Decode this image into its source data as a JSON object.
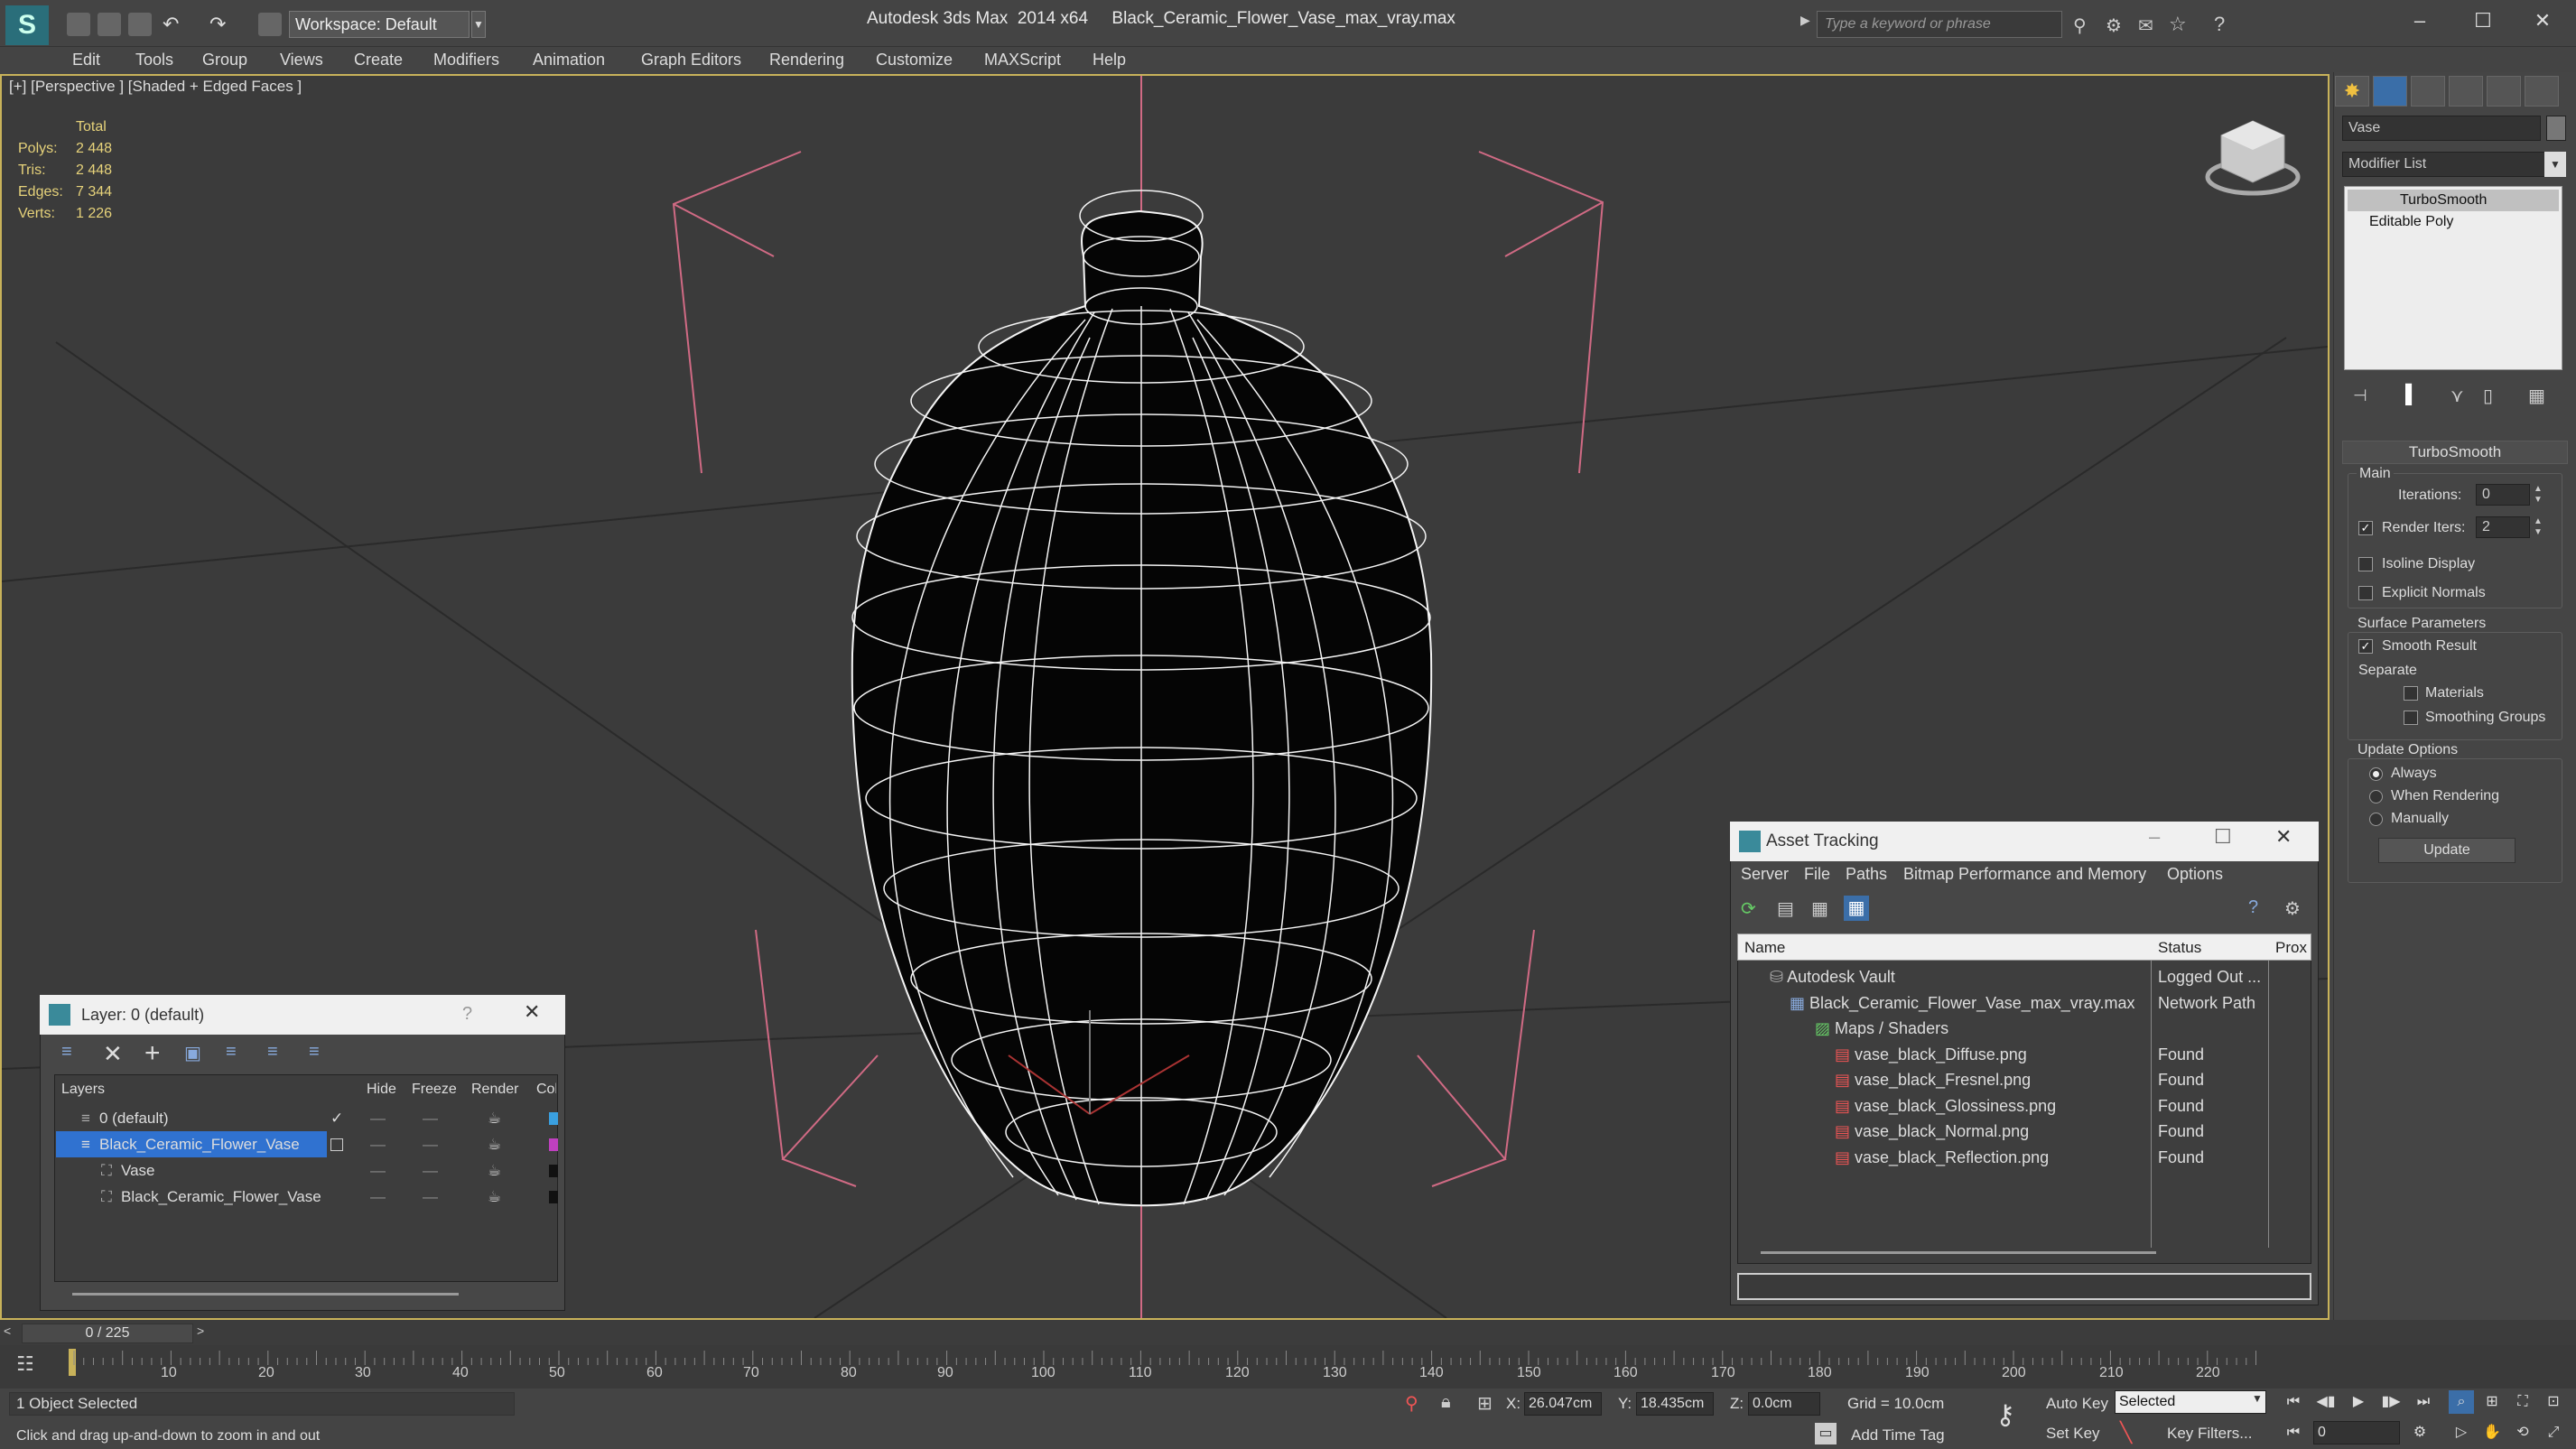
{
  "app": {
    "title": "Autodesk 3ds Max  2014 x64     Black_Ceramic_Flower_Vase_max_vray.max",
    "workspace": "Workspace: Default",
    "search_placeholder": "Type a keyword or phrase"
  },
  "menu": [
    "Edit",
    "Tools",
    "Group",
    "Views",
    "Create",
    "Modifiers",
    "Animation",
    "Graph Editors",
    "Rendering",
    "Customize",
    "MAXScript",
    "Help"
  ],
  "viewport": {
    "label": "[+] [Perspective ] [Shaded + Edged Faces ]",
    "stats": {
      "header": "Total",
      "rows": [
        {
          "label": "Polys:",
          "value": "2 448"
        },
        {
          "label": "Tris:",
          "value": "2 448"
        },
        {
          "label": "Edges:",
          "value": "7 344"
        },
        {
          "label": "Verts:",
          "value": "1 226"
        }
      ]
    }
  },
  "command_panel": {
    "object_name": "Vase",
    "modifier_list": "Modifier List",
    "stack": [
      "TurboSmooth",
      "Editable Poly"
    ],
    "rollout_title": "TurboSmooth",
    "main_group": "Main",
    "iterations_label": "Iterations:",
    "iterations_value": "0",
    "render_iters_label": "Render Iters:",
    "render_iters_value": "2",
    "isoline": "Isoline Display",
    "explicit_normals": "Explicit Normals",
    "surface_params": "Surface Parameters",
    "smooth_result": "Smooth Result",
    "separate": "Separate",
    "materials": "Materials",
    "smoothing_groups": "Smoothing Groups",
    "update_options": "Update Options",
    "always": "Always",
    "when_rendering": "When Rendering",
    "manually": "Manually",
    "update_button": "Update"
  },
  "layer_dialog": {
    "title": "Layer: 0 (default)",
    "help": "?",
    "columns": [
      "Layers",
      "Hide",
      "Freeze",
      "Render",
      "Col"
    ],
    "rows": [
      {
        "name": "0 (default)",
        "color": "#3aa0e0"
      },
      {
        "name": "Black_Ceramic_Flower_Vase",
        "color": "#c040c0"
      },
      {
        "name": "Vase",
        "color": "#111111"
      },
      {
        "name": "Black_Ceramic_Flower_Vase",
        "color": "#111111"
      }
    ]
  },
  "asset_dialog": {
    "title": "Asset Tracking",
    "menu": [
      "Server",
      "File",
      "Paths",
      "Bitmap Performance and Memory",
      "Options"
    ],
    "columns": [
      "Name",
      "Status",
      "Prox"
    ],
    "rows": [
      {
        "name": "Autodesk Vault",
        "status": "Logged Out ..."
      },
      {
        "name": "Black_Ceramic_Flower_Vase_max_vray.max",
        "status": "Network Path"
      },
      {
        "name": "Maps / Shaders",
        "status": ""
      },
      {
        "name": "vase_black_Diffuse.png",
        "status": "Found"
      },
      {
        "name": "vase_black_Fresnel.png",
        "status": "Found"
      },
      {
        "name": "vase_black_Glossiness.png",
        "status": "Found"
      },
      {
        "name": "vase_black_Normal.png",
        "status": "Found"
      },
      {
        "name": "vase_black_Reflection.png",
        "status": "Found"
      }
    ]
  },
  "timeline": {
    "frame": "0 / 225",
    "ticks": [
      "10",
      "20",
      "30",
      "40",
      "50",
      "60",
      "70",
      "80",
      "90",
      "100",
      "110",
      "120",
      "130",
      "140",
      "150",
      "160",
      "170",
      "180",
      "190",
      "200",
      "210",
      "220"
    ]
  },
  "status": {
    "selected": "1 Object Selected",
    "hint": "Click and drag up-and-down to zoom in and out",
    "x_label": "X:",
    "x_value": "26.047cm",
    "y_label": "Y:",
    "y_value": "18.435cm",
    "z_label": "Z:",
    "z_value": "0.0cm",
    "grid": "Grid = 10.0cm",
    "add_time_tag": "Add Time Tag",
    "auto_key": "Auto Key",
    "selected_dropdown": "Selected",
    "set_key": "Set Key",
    "key_filters": "Key Filters...",
    "frame_value": "0"
  }
}
